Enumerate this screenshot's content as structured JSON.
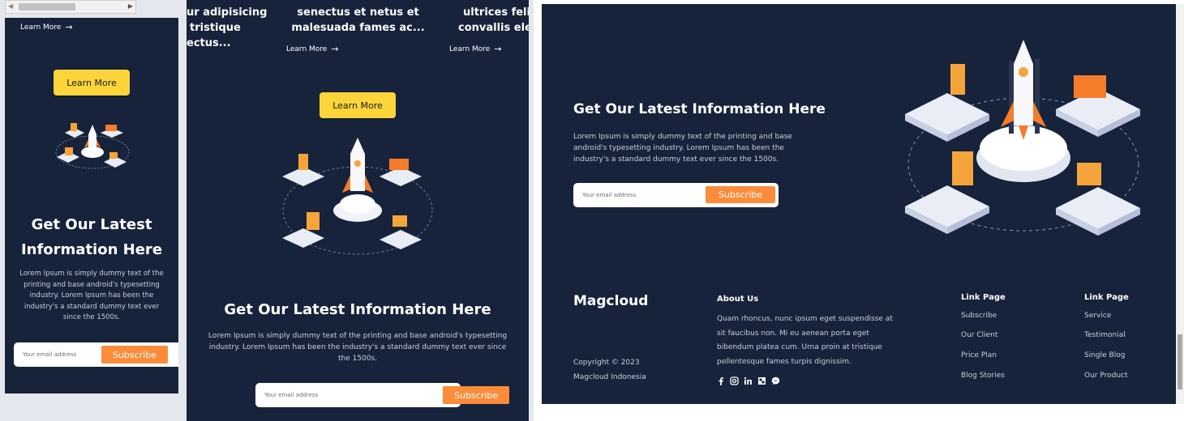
{
  "scrollbar": {
    "left_arrow": "◀",
    "right_arrow": "▶"
  },
  "panel1": {
    "learn_more": "Learn More",
    "cta_label": "Learn More",
    "heading_line1": "Get Our Latest",
    "heading_line2": "Information Here",
    "body": "Lorem Ipsum is simply dummy text of the printing and base android's typesetting industry. Lorem Ipsum has been the industry's a standard dummy text ever since the 1500s.",
    "email_placeholder": "Your email address",
    "subscribe_label": "Subscribe"
  },
  "panel2": {
    "card_a_line1": "ur adipisicing",
    "card_a_line2": "tristique",
    "card_a_line3": "ectus...",
    "card_b_line1": "senectus et netus et",
    "card_b_line2": "malesuada fames ac...",
    "card_c_line1": "ultrices felis",
    "card_c_line2": "convallis ele",
    "learn_more": "Learn More",
    "cta_label": "Learn More",
    "heading": "Get Our Latest Information Here",
    "body": "Lorem Ipsum is simply dummy text of the printing and base android's typesetting industry. Lorem Ipsum has been the industry's a standard dummy text ever since the 1500s.",
    "email_placeholder": "Your email address",
    "subscribe_label": "Subscribe"
  },
  "panel3": {
    "heading": "Get Our Latest Information Here",
    "body": "Lorem Ipsum is simply dummy text of the printing and base android's typesetting industry. Lorem Ipsum has been the industry's a standard dummy text ever since the 1500s.",
    "email_placeholder": "Your email address",
    "subscribe_label": "Subscribe",
    "footer": {
      "brand": "Magcloud",
      "copyright": "Copyright © 2023",
      "company": "Magcloud Indonesia",
      "about_title": "About Us",
      "about_text": "Quam rhoncus, nunc ipsum eget suspendisse at sit faucibus non. Mi eu aenean porta eget bibendum platea cum. Urna proin at tristique pellentesque fames turpis dignissim.",
      "col1_title": "Link Page",
      "col1_links": [
        "Subscribe",
        "Our Client",
        "Price Plan",
        "Blog Stories"
      ],
      "col2_title": "Link Page",
      "col2_links": [
        "Service",
        "Testimonial",
        "Single Blog",
        "Our Product"
      ],
      "social_icons": [
        "facebook-icon",
        "instagram-icon",
        "linkedin-icon",
        "grid-icon",
        "messenger-icon"
      ]
    }
  },
  "colors": {
    "bg": "#17233a",
    "accent_yellow": "#fcd53b",
    "accent_orange": "#fb8c3a"
  }
}
